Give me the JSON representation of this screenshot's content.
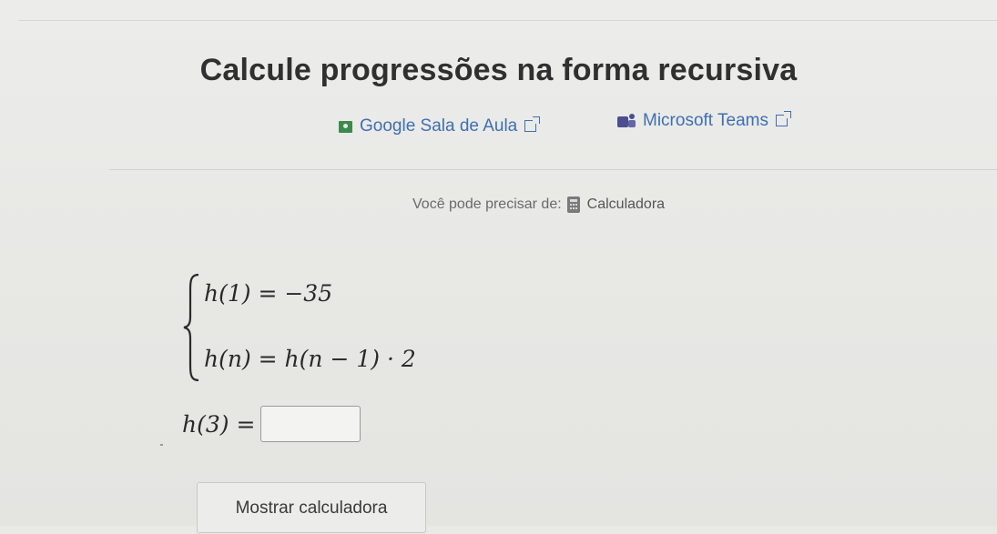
{
  "title": "Calcule progressões na forma recursiva",
  "integrations": {
    "google": {
      "label": "Google Sala de Aula",
      "icon": "google-classroom-icon",
      "color": "#3c8a4e"
    },
    "teams": {
      "label": "Microsoft Teams",
      "icon": "microsoft-teams-icon",
      "color": "#4b4f8f"
    },
    "link_color": "#3f6fb0"
  },
  "need": {
    "label": "Você pode precisar de:",
    "tool": "Calculadora",
    "icon": "calculator-icon"
  },
  "problem": {
    "line1": "h(1) = −35",
    "line2": "h(n) = h(n − 1) · 2",
    "question_label": "h(3) =",
    "answer_value": ""
  },
  "buttons": {
    "show_calculator": "Mostrar calculadora"
  }
}
